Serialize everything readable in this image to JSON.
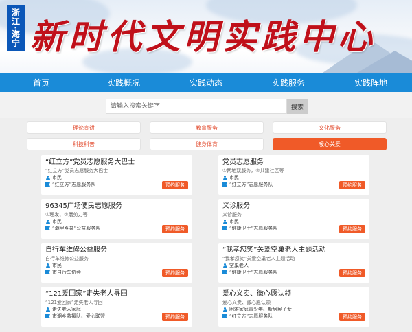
{
  "banner": {
    "region": "浙江·海宁",
    "title": "新时代文明实践中心"
  },
  "nav": {
    "items": [
      "首页",
      "实践概况",
      "实践动态",
      "实践服务",
      "实践阵地"
    ]
  },
  "search": {
    "placeholder": "请输入搜索关键字",
    "button": "搜索"
  },
  "categories": [
    {
      "label": "理论宣讲",
      "active": false
    },
    {
      "label": "教育服务",
      "active": false
    },
    {
      "label": "文化服务",
      "active": false
    },
    {
      "label": "科技科普",
      "active": false
    },
    {
      "label": "健身体育",
      "active": false
    },
    {
      "label": "暖心关爱",
      "active": true
    }
  ],
  "book_label": "预约服务",
  "cards": [
    {
      "title": "“红立方”党员志愿服务大巴士",
      "subtitle": "“红立方”党员志愿服务大巴士",
      "audience": "市民",
      "team": "“红立方”志愿服务队"
    },
    {
      "title": "党员志愿服务",
      "subtitle": "①两地双服务，②共建社区等",
      "audience": "市民",
      "team": "“红立方”志愿服务队"
    },
    {
      "title": "96345广场便民志愿服务",
      "subtitle": "①理发、②磨剪刀等",
      "audience": "市民",
      "team": "“潮里乡亲”公益服务队"
    },
    {
      "title": "义诊服务",
      "subtitle": "义诊服务",
      "audience": "市民",
      "team": "“健康卫士”志愿服务队"
    },
    {
      "title": "自行车维修公益服务",
      "subtitle": "自行车维修公益服务",
      "audience": "市民",
      "team": "市自行车协会"
    },
    {
      "title": "“我孝您笑”关爱空巢老人主题活动",
      "subtitle": "“我孝您笑”关爱空巢老人主题活动",
      "audience": "空巢老人",
      "team": "“健康卫士”志愿服务队"
    },
    {
      "title": "“121爱回家”走失老人寻回",
      "subtitle": "“121爱回家”走失老人寻回",
      "audience": "走失老人家庭",
      "team": "市潮乡救援队、爱心联盟"
    },
    {
      "title": "爱心义卖、微心愿认领",
      "subtitle": "爱心义卖、微心愿认领",
      "audience": "困难家庭青少年、新居民子女",
      "team": "“红立方”志愿服务队"
    }
  ],
  "colors": {
    "nav": "#1a8bd8",
    "accent": "#f05a28",
    "title": "#c0101a",
    "badge": "#0b57b8"
  }
}
